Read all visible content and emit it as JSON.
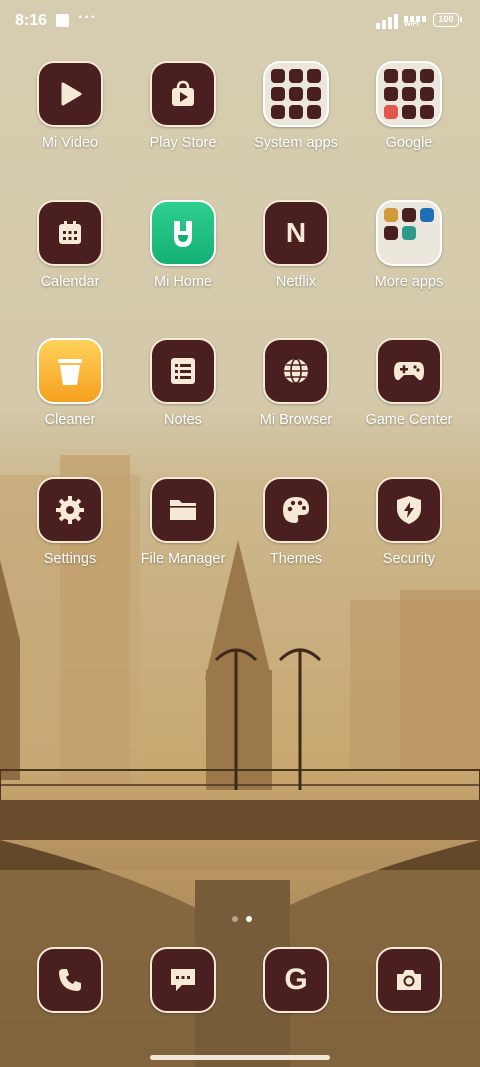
{
  "status": {
    "time": "8:16",
    "wifi_label": "WiFi",
    "battery": "100"
  },
  "apps": [
    {
      "label": "Mi Video",
      "icon": "play-icon"
    },
    {
      "label": "Play Store",
      "icon": "play-store-icon"
    },
    {
      "label": "System apps",
      "icon": "folder-icon"
    },
    {
      "label": "Google",
      "icon": "folder-icon"
    },
    {
      "label": "Calendar",
      "icon": "calendar-icon"
    },
    {
      "label": "Mi Home",
      "icon": "mi-home-icon"
    },
    {
      "label": "Netflix",
      "icon": "netflix-icon",
      "glyph": "N"
    },
    {
      "label": "More apps",
      "icon": "folder-icon"
    },
    {
      "label": "Cleaner",
      "icon": "trash-icon"
    },
    {
      "label": "Notes",
      "icon": "notes-icon"
    },
    {
      "label": "Mi Browser",
      "icon": "globe-icon"
    },
    {
      "label": "Game Center",
      "icon": "gamepad-icon"
    },
    {
      "label": "Settings",
      "icon": "gear-icon"
    },
    {
      "label": "File Manager",
      "icon": "folder-open-icon"
    },
    {
      "label": "Themes",
      "icon": "palette-icon"
    },
    {
      "label": "Security",
      "icon": "shield-icon"
    }
  ],
  "dock": [
    {
      "icon": "phone-icon"
    },
    {
      "icon": "messages-icon"
    },
    {
      "icon": "google-icon",
      "glyph": "G"
    },
    {
      "icon": "camera-icon"
    }
  ],
  "pager": {
    "pages": 2,
    "current": 2
  },
  "colors": {
    "icon_bg": "#4a1f1f",
    "icon_border": "#f6ead6",
    "glyph": "#f6ead6"
  }
}
